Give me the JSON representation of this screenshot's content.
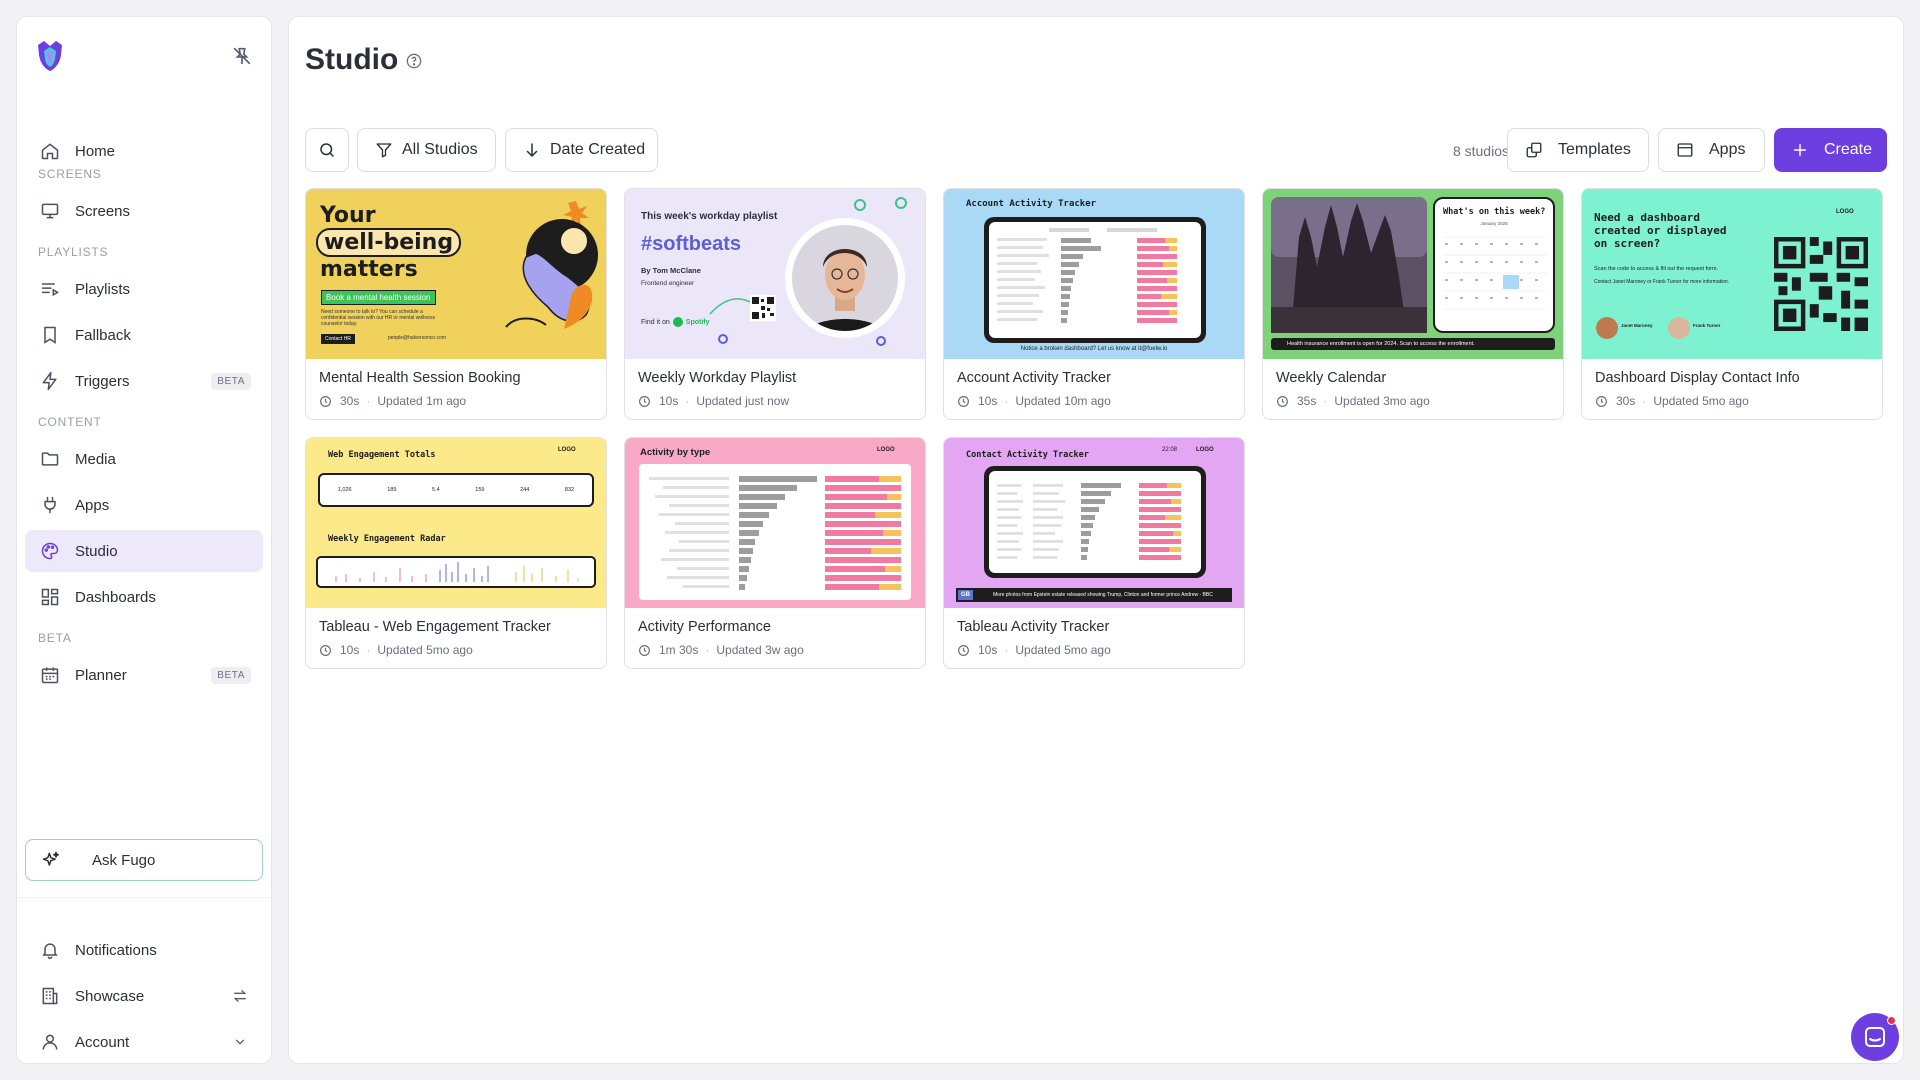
{
  "sidebar": {
    "nav": {
      "home": "Home",
      "screens_section": "SCREENS",
      "screens": "Screens",
      "playlists_section": "PLAYLISTS",
      "playlists": "Playlists",
      "fallback": "Fallback",
      "triggers": "Triggers",
      "triggers_badge": "BETA",
      "content_section": "CONTENT",
      "media": "Media",
      "apps": "Apps",
      "studio": "Studio",
      "dashboards": "Dashboards",
      "beta_section": "BETA",
      "planner": "Planner",
      "planner_badge": "BETA"
    },
    "ask_fugo": "Ask Fugo",
    "footer": {
      "notifications": "Notifications",
      "showcase": "Showcase",
      "account": "Account"
    }
  },
  "main": {
    "title": "Studio",
    "toolbar": {
      "filter_label": "All Studios",
      "sort_label": "Date Created",
      "count": "8 studios",
      "templates_label": "Templates",
      "apps_label": "Apps",
      "create_label": "Create"
    },
    "cards": [
      {
        "title": "Mental Health Session Booking",
        "duration": "30s",
        "updated": "Updated 1m ago",
        "thumb": {
          "h1": "Your",
          "h2": "well-being",
          "h3": "matters",
          "cta": "Book a mental health session",
          "body": "Need someone to talk to? You can schedule a confidential session with our HR or mental wellness counselor today.",
          "contact": "Contact HR",
          "email": "people@halversonco.com"
        }
      },
      {
        "title": "Weekly Workday Playlist",
        "duration": "10s",
        "updated": "Updated just now",
        "thumb": {
          "kicker": "This week's workday playlist",
          "tag": "#softbeats",
          "by": "By Tom McClane",
          "role": "Frontend engineer",
          "find": "Find it on",
          "spotify": "Spotify"
        }
      },
      {
        "title": "Account Activity Tracker",
        "duration": "10s",
        "updated": "Updated 10m ago",
        "thumb": {
          "heading": "Account Activity Tracker",
          "footer": "Notice a broken dashboard? Let us know at it@fuelw.io"
        }
      },
      {
        "title": "Weekly Calendar",
        "duration": "35s",
        "updated": "Updated 3mo ago",
        "thumb": {
          "heading": "What's on this week?",
          "month": "January 2025",
          "banner": "Health insurance enrollment is open for 2024. Scan to access the enrollment."
        }
      },
      {
        "title": "Dashboard Display Contact Info",
        "duration": "30s",
        "updated": "Updated 5mo ago",
        "thumb": {
          "heading": "Need a dashboard created or displayed on screen?",
          "body1": "Scan the code to access & fill out the request form.",
          "body2": "Contact Janet Maroney or Frank Turner for more information.",
          "logo": "LOGO",
          "person1": "Janet Maroney",
          "person2": "Frank Turner"
        }
      },
      {
        "title": "Tableau - Web Engagement Tracker",
        "duration": "10s",
        "updated": "Updated 5mo ago",
        "thumb": {
          "heading": "Web Engagement Totals",
          "heading2": "Weekly Engagement Radar",
          "logo": "LOGO",
          "values": [
            "1,026",
            "189",
            "5.4",
            "159",
            "244",
            "832"
          ]
        }
      },
      {
        "title": "Activity Performance",
        "duration": "1m 30s",
        "updated": "Updated 3w ago",
        "thumb": {
          "heading": "Activity by type",
          "logo": "LOGO"
        }
      },
      {
        "title": "Tableau Activity Tracker",
        "duration": "10s",
        "updated": "Updated 5mo ago",
        "thumb": {
          "heading": "Contact Activity Tracker",
          "time": "22:08",
          "logo": "LOGO",
          "ticker_tag": "GB",
          "ticker": "More photos from Epstein estate released showing Trump, Clinton and former prince Andrew - BBC"
        }
      }
    ]
  },
  "colors": {
    "accent": "#6e3fe0",
    "active_bg": "#ede9fb"
  }
}
